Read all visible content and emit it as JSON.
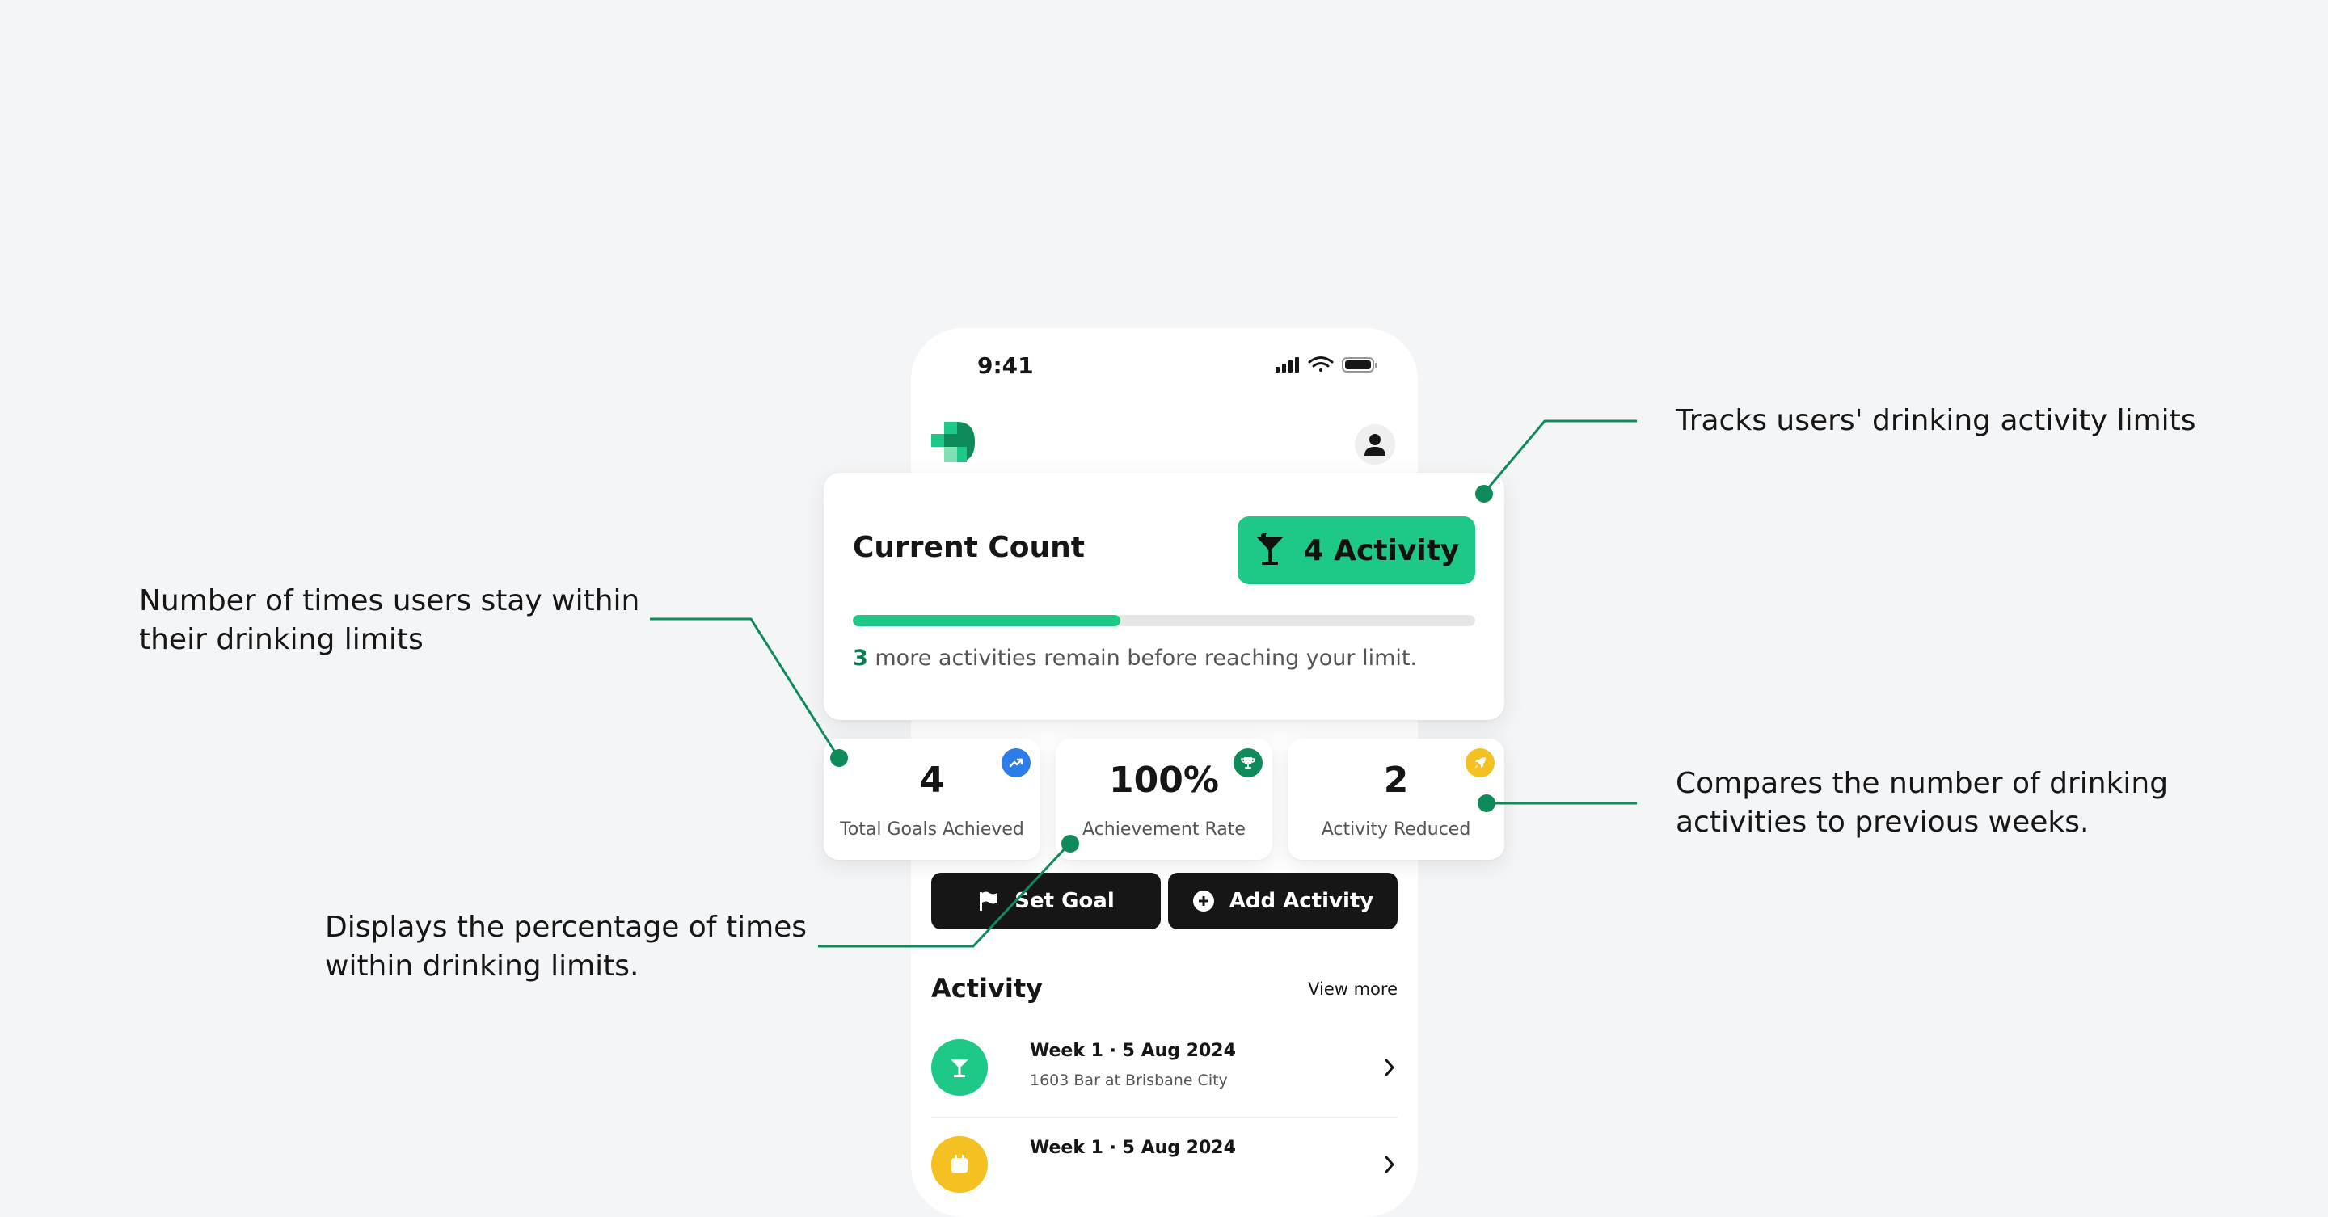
{
  "status_bar": {
    "time": "9:41"
  },
  "current_count": {
    "title": "Current Count",
    "badge_label": "4 Activity",
    "progress_fraction": 0.43,
    "remaining_number": "3",
    "remaining_text": " more activities remain before reaching your limit."
  },
  "stats": [
    {
      "value": "4",
      "label": "Total Goals Achieved",
      "icon": "trending-up-icon",
      "color": "#2b7de9"
    },
    {
      "value": "100%",
      "label": "Achievement Rate",
      "icon": "trophy-icon",
      "color": "#0f8a5a"
    },
    {
      "value": "2",
      "label": "Activity Reduced",
      "icon": "rocket-icon",
      "color": "#f5c021"
    }
  ],
  "actions": {
    "set_goal": "Set Goal",
    "add_activity": "Add Activity"
  },
  "activity": {
    "title": "Activity",
    "view_more": "View more",
    "items": [
      {
        "title": "Week 1 · 5 Aug 2024",
        "subtitle": "1603 Bar at Brisbane City",
        "icon": "cocktail-icon",
        "color": "#1ec887"
      },
      {
        "title": "Week 1 · 5 Aug 2024",
        "subtitle": "",
        "icon": "calendar-icon",
        "color": "#f5c021"
      }
    ]
  },
  "annotations": {
    "tracks": "Tracks users' drinking activity limits",
    "times_within_l1": "Number of times users stay within",
    "times_within_l2": "their drinking limits",
    "compares_l1": "Compares the number of drinking",
    "compares_l2": "activities to previous weeks.",
    "percentage_l1": "Displays the percentage of times",
    "percentage_l2": "within drinking limits."
  },
  "colors": {
    "accent": "#1ec887",
    "callout_line": "#0f8a5a",
    "dark": "#161616",
    "background": "#f4f5f7"
  }
}
